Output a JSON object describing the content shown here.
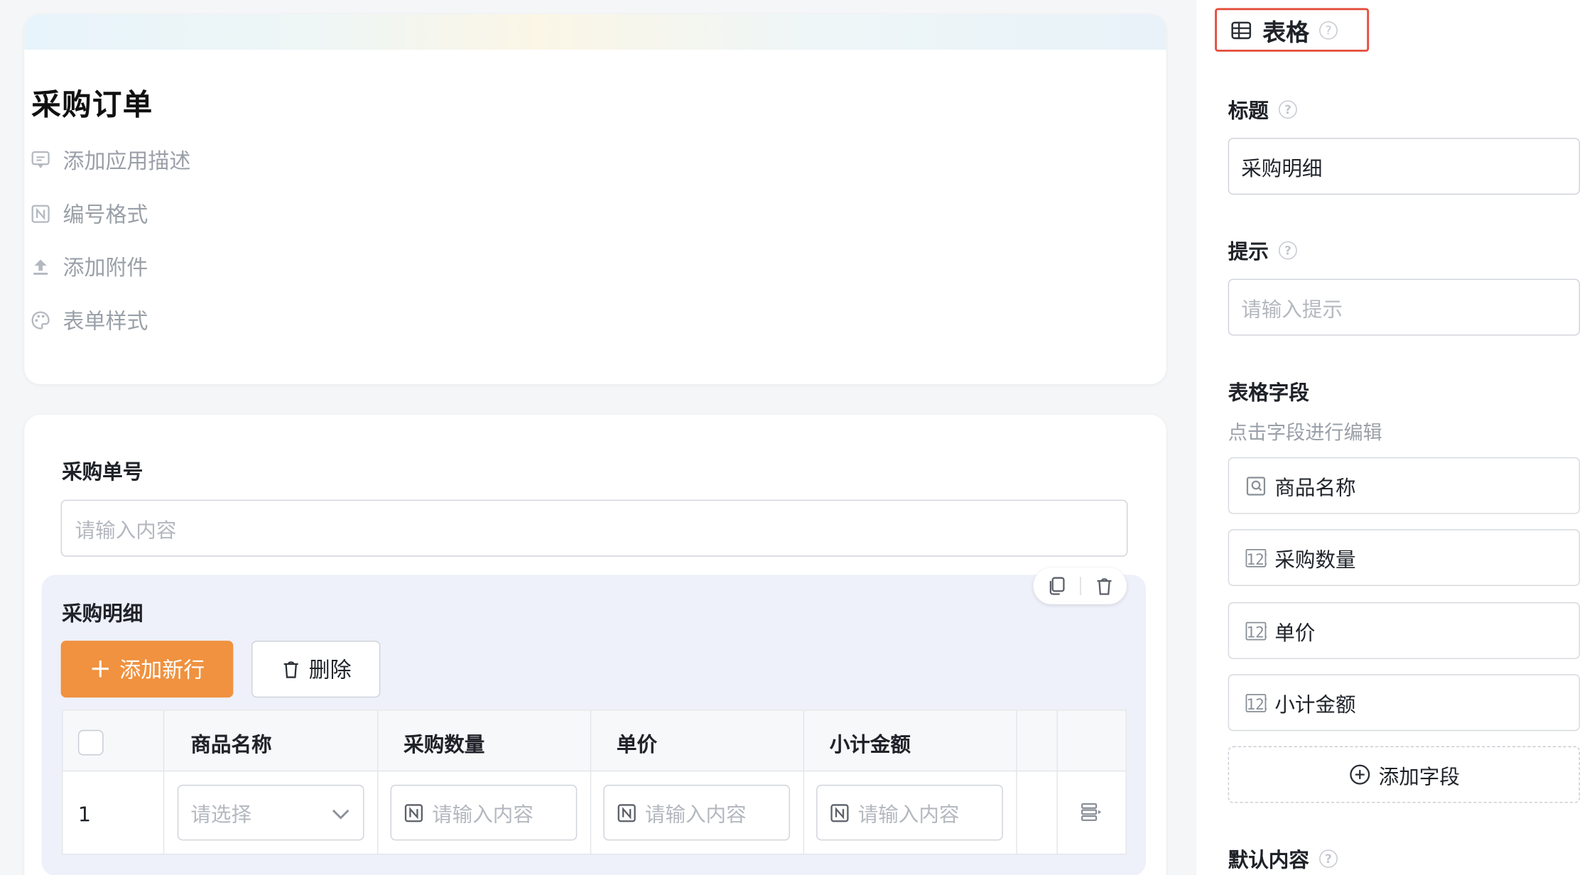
{
  "form": {
    "title": "采购订单",
    "options": [
      {
        "label": "添加应用描述",
        "icon": "comment-icon"
      },
      {
        "label": "编号格式",
        "icon": "number-format-icon"
      },
      {
        "label": "添加附件",
        "icon": "upload-icon"
      },
      {
        "label": "表单样式",
        "icon": "palette-icon"
      }
    ]
  },
  "fields": {
    "order_no": {
      "label": "采购单号",
      "placeholder": "请输入内容"
    },
    "detail": {
      "label": "采购明细",
      "add_row_label": "添加新行",
      "delete_label": "删除",
      "columns": [
        "商品名称",
        "采购数量",
        "单价",
        "小计金额"
      ],
      "rows": [
        {
          "index": "1",
          "product_placeholder": "请选择",
          "qty_placeholder": "请输入内容",
          "price_placeholder": "请输入内容",
          "subtotal_placeholder": "请输入内容"
        }
      ]
    }
  },
  "panel": {
    "header": "表格",
    "help_mark": "?",
    "title_label": "标题",
    "title_value": "采购明细",
    "hint_label": "提示",
    "hint_placeholder": "请输入提示",
    "fields_label": "表格字段",
    "fields_subtitle": "点击字段进行编辑",
    "field_items": [
      {
        "label": "商品名称",
        "icon": "select-field-icon"
      },
      {
        "label": "采购数量",
        "icon": "number-field-icon"
      },
      {
        "label": "单价",
        "icon": "number-field-icon"
      },
      {
        "label": "小计金额",
        "icon": "number-field-icon"
      }
    ],
    "add_field_label": "添加字段",
    "default_label": "默认内容"
  },
  "colors": {
    "accent": "#f0923f",
    "highlight": "#e54d3c"
  }
}
